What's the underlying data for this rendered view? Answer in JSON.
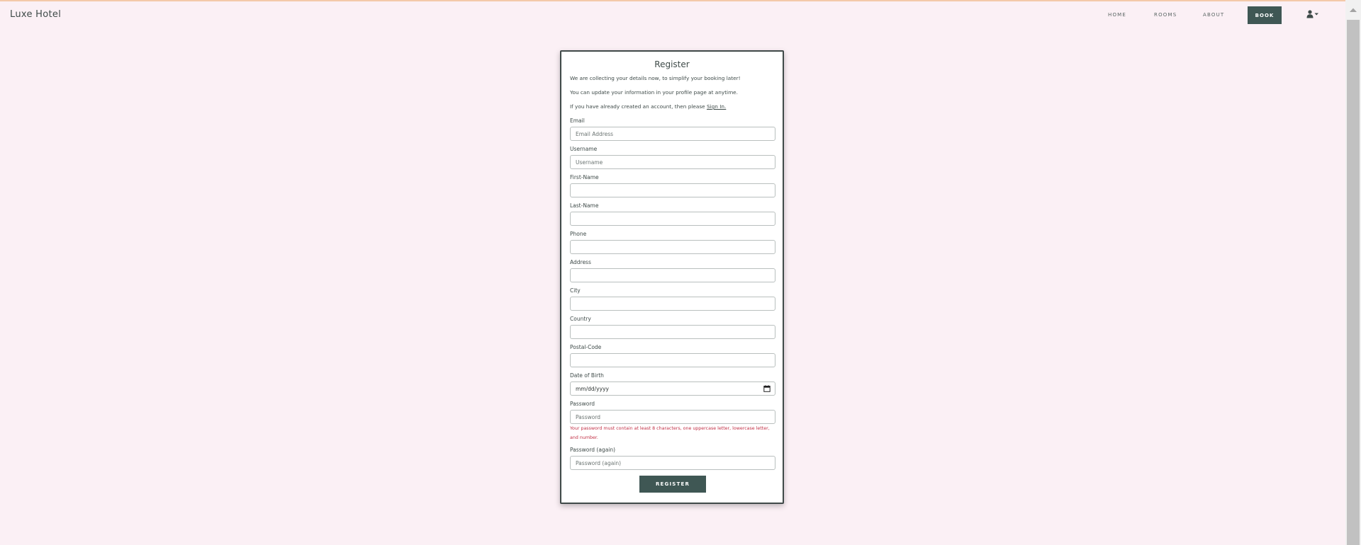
{
  "navbar": {
    "brand": "Luxe Hotel",
    "links": [
      "HOME",
      "ROOMS",
      "ABOUT"
    ],
    "book_label": "BOOK",
    "user_icon": "user-icon",
    "caret_icon": "caret-down-icon"
  },
  "colors": {
    "background": "#fbf0f5",
    "accent": "#3f5754",
    "error": "#c23046",
    "text": "#3e4a48"
  },
  "form": {
    "title": "Register",
    "intro_lines": [
      "We are collecting your details now, to simplify your booking later!",
      "You can update your information in your profile page at anytime.",
      "If you have already created an account, then please"
    ],
    "signin_link": "Sign In.",
    "fields": [
      {
        "label": "Email",
        "placeholder": "Email Address",
        "value": ""
      },
      {
        "label": "Username",
        "placeholder": "Username",
        "value": ""
      },
      {
        "label": "First-Name",
        "placeholder": "",
        "value": ""
      },
      {
        "label": "Last-Name",
        "placeholder": "",
        "value": ""
      },
      {
        "label": "Phone",
        "placeholder": "",
        "value": ""
      },
      {
        "label": "Address",
        "placeholder": "",
        "value": ""
      },
      {
        "label": "City",
        "placeholder": "",
        "value": ""
      },
      {
        "label": "Country",
        "placeholder": "",
        "value": ""
      },
      {
        "label": "Postal-Code",
        "placeholder": "",
        "value": ""
      },
      {
        "label": "Date of Birth",
        "placeholder": "mm/dd/yyyy",
        "value": ""
      },
      {
        "label": "Password",
        "placeholder": "Password",
        "value": ""
      },
      {
        "label": "Password (again)",
        "placeholder": "Password (again)",
        "value": ""
      }
    ],
    "password_error": "Your password must contain at least 8 characters, one uppercase letter, lowercase letter, and number.",
    "submit_label": "REGISTER"
  }
}
